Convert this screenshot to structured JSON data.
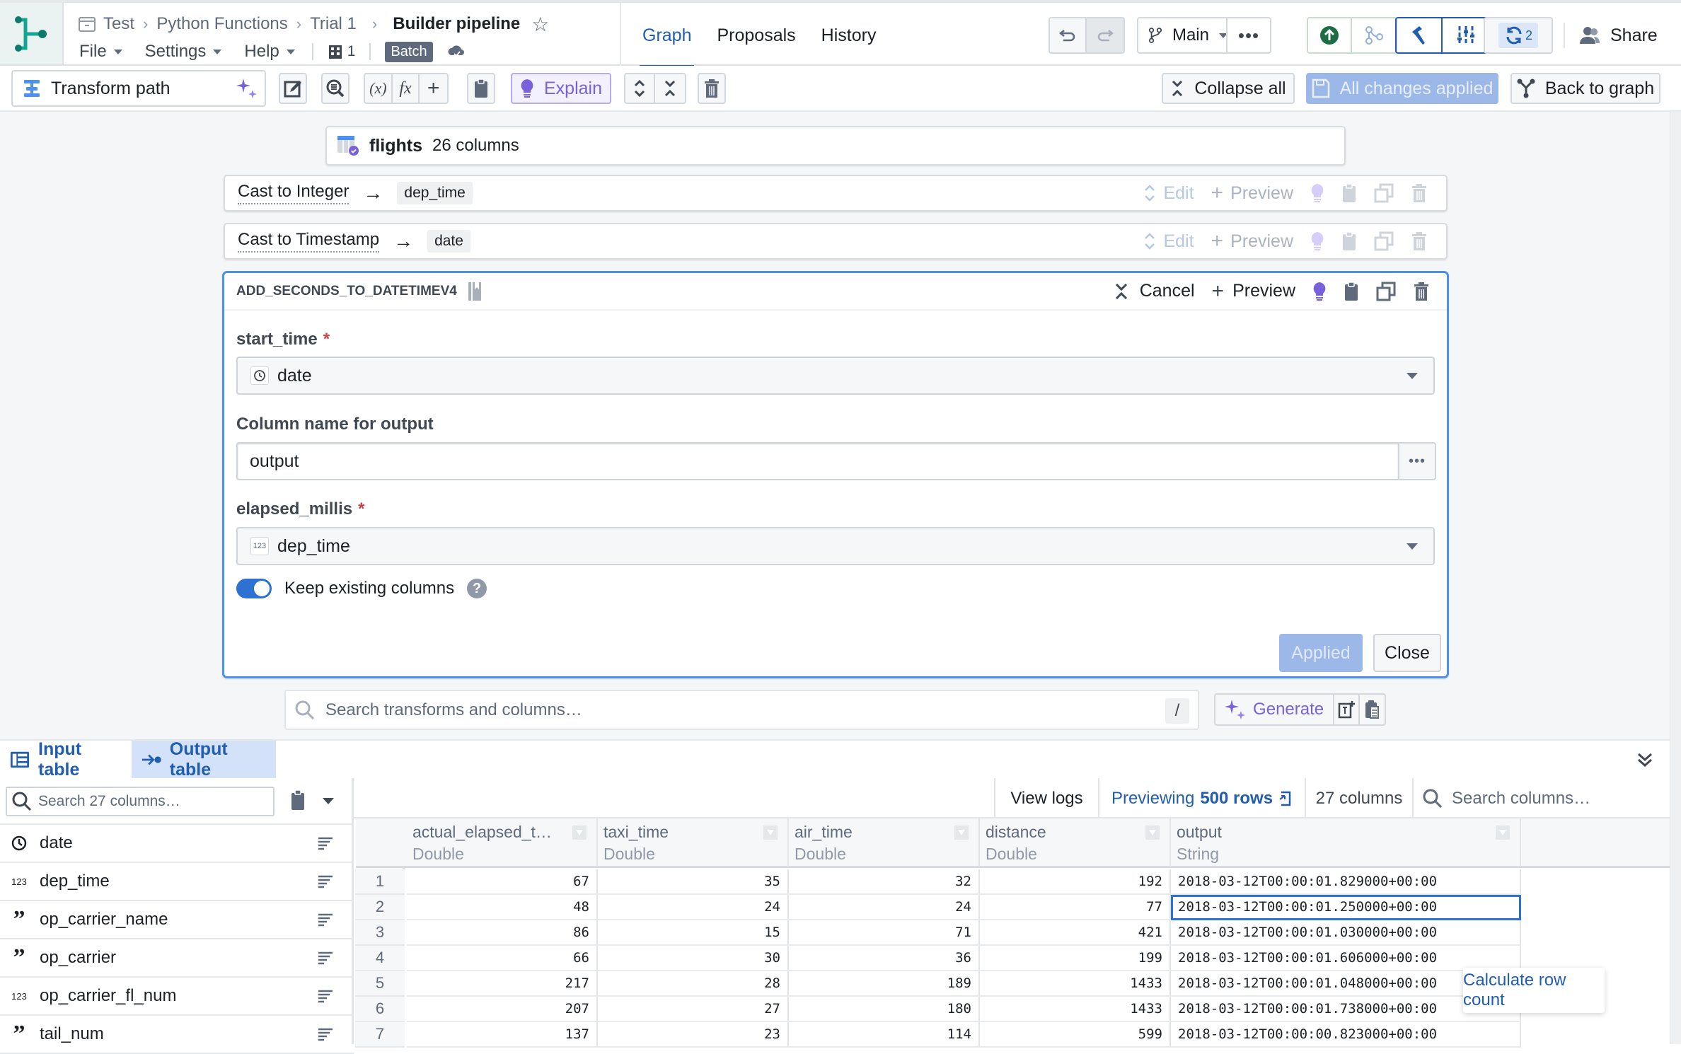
{
  "header": {
    "breadcrumb": [
      "Test",
      "Python Functions",
      "Trial 1"
    ],
    "title": "Builder pipeline",
    "menus": [
      "File",
      "Settings",
      "Help"
    ],
    "build_count": "1",
    "mode_badge": "Batch",
    "tabs": [
      "Graph",
      "Proposals",
      "History"
    ],
    "active_tab": "Graph",
    "branch": "Main",
    "sync_count": "2",
    "share_label": "Share"
  },
  "toolbar": {
    "transform_path_label": "Transform path",
    "explain_label": "Explain",
    "collapse_all_label": "Collapse all",
    "all_changes_label": "All changes applied",
    "back_to_graph_label": "Back to graph"
  },
  "input_node": {
    "name": "flights",
    "columns": "26 columns"
  },
  "transforms": [
    {
      "name": "Cast to Integer",
      "target": "dep_time",
      "edit_label": "Edit",
      "preview_label": "Preview"
    },
    {
      "name": "Cast to Timestamp",
      "target": "date",
      "edit_label": "Edit",
      "preview_label": "Preview"
    }
  ],
  "active_transform": {
    "name": "ADD_SECONDS_TO_DATETIMEV4",
    "cancel_label": "Cancel",
    "preview_label": "Preview",
    "fields": {
      "start_time": {
        "label": "start_time",
        "required": "*",
        "value": "date",
        "type_icon": "clock-icon"
      },
      "output_name": {
        "label": "Column name for output",
        "value": "output"
      },
      "elapsed_millis": {
        "label": "elapsed_millis",
        "required": "*",
        "value": "dep_time",
        "type_icon": "123"
      }
    },
    "keep_columns_label": "Keep existing columns",
    "keep_columns_on": true,
    "applied_label": "Applied",
    "close_label": "Close"
  },
  "search": {
    "placeholder": "Search transforms and columns…",
    "shortcut": "/",
    "generate_label": "Generate"
  },
  "bottom": {
    "tabs": [
      "Input table",
      "Output table"
    ],
    "active_tab": "Output table",
    "column_search_placeholder": "Search 27 columns…",
    "columns": [
      {
        "type": "clock",
        "name": "date"
      },
      {
        "type": "123",
        "name": "dep_time"
      },
      {
        "type": "string",
        "name": "op_carrier_name"
      },
      {
        "type": "string",
        "name": "op_carrier"
      },
      {
        "type": "123",
        "name": "op_carrier_fl_num"
      },
      {
        "type": "string",
        "name": "tail_num"
      }
    ],
    "view_logs_label": "View logs",
    "previewing_label": "Previewing",
    "previewing_rows": "500 rows",
    "column_count": "27 columns",
    "search_columns_placeholder": "Search columns…",
    "table": {
      "headers": [
        {
          "name": "actual_elapsed_t…",
          "type": "Double"
        },
        {
          "name": "taxi_time",
          "type": "Double"
        },
        {
          "name": "air_time",
          "type": "Double"
        },
        {
          "name": "distance",
          "type": "Double"
        },
        {
          "name": "output",
          "type": "String"
        }
      ],
      "rows": [
        [
          "1",
          "67",
          "35",
          "32",
          "192",
          "2018-03-12T00:00:01.829000+00:00"
        ],
        [
          "2",
          "48",
          "24",
          "24",
          "77",
          "2018-03-12T00:00:01.250000+00:00"
        ],
        [
          "3",
          "86",
          "15",
          "71",
          "421",
          "2018-03-12T00:00:01.030000+00:00"
        ],
        [
          "4",
          "66",
          "30",
          "36",
          "199",
          "2018-03-12T00:00:01.606000+00:00"
        ],
        [
          "5",
          "217",
          "28",
          "189",
          "1433",
          "2018-03-12T00:00:01.048000+00:00"
        ],
        [
          "6",
          "207",
          "27",
          "180",
          "1433",
          "2018-03-12T00:00:01.738000+00:00"
        ],
        [
          "7",
          "137",
          "23",
          "114",
          "599",
          "2018-03-12T00:00:00.823000+00:00"
        ]
      ],
      "selected_cell": {
        "row": 2,
        "column": "output"
      }
    },
    "row_count_tooltip": "Calculate row count"
  },
  "colors": {
    "accent": "#215db0",
    "ai_purple": "#7961db",
    "applied_disabled": "#9bb8e8",
    "success_green": "#1c6e42"
  }
}
